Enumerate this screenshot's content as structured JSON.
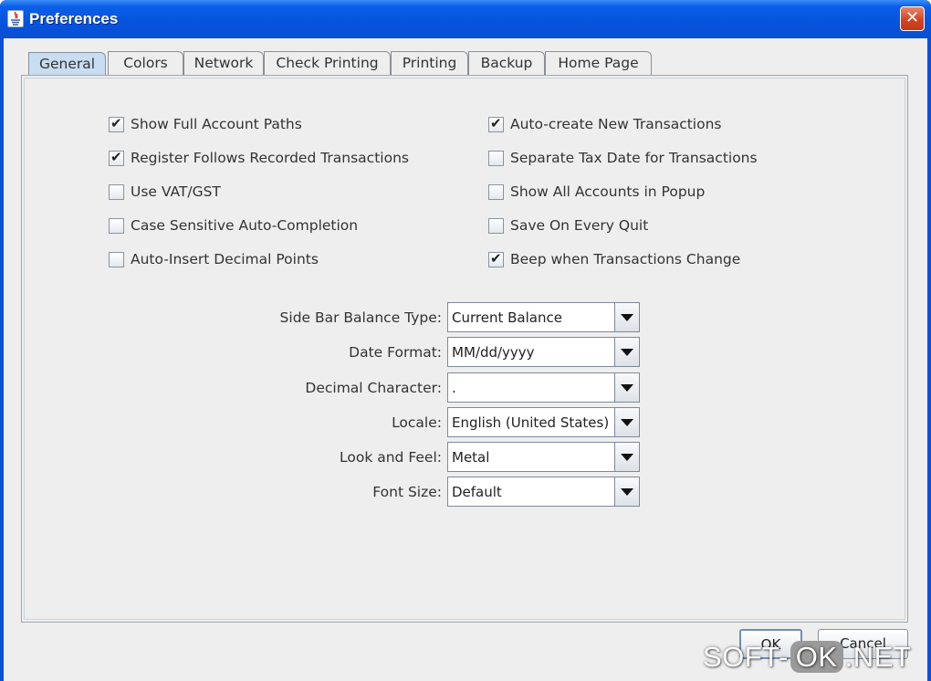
{
  "window": {
    "title": "Preferences",
    "close_glyph": "✕"
  },
  "tabs": [
    {
      "label": "General",
      "active": true
    },
    {
      "label": "Colors",
      "active": false
    },
    {
      "label": "Network",
      "active": false
    },
    {
      "label": "Check Printing",
      "active": false
    },
    {
      "label": "Printing",
      "active": false
    },
    {
      "label": "Backup",
      "active": false
    },
    {
      "label": "Home Page",
      "active": false
    }
  ],
  "general": {
    "checkboxes_left": [
      {
        "label": "Show Full Account Paths",
        "checked": true
      },
      {
        "label": "Register Follows Recorded Transactions",
        "checked": true
      },
      {
        "label": "Use VAT/GST",
        "checked": false
      },
      {
        "label": "Case Sensitive Auto-Completion",
        "checked": false
      },
      {
        "label": "Auto-Insert Decimal Points",
        "checked": false
      }
    ],
    "checkboxes_right": [
      {
        "label": "Auto-create New Transactions",
        "checked": true
      },
      {
        "label": "Separate Tax Date for Transactions",
        "checked": false
      },
      {
        "label": "Show All Accounts in Popup",
        "checked": false
      },
      {
        "label": "Save On Every Quit",
        "checked": false
      },
      {
        "label": "Beep when Transactions Change",
        "checked": true
      }
    ],
    "fields": [
      {
        "label": "Side Bar Balance Type:",
        "value": "Current Balance"
      },
      {
        "label": "Date Format:",
        "value": "MM/dd/yyyy"
      },
      {
        "label": "Decimal Character:",
        "value": "."
      },
      {
        "label": "Locale:",
        "value": "English (United States)"
      },
      {
        "label": "Look and Feel:",
        "value": "Metal"
      },
      {
        "label": "Font Size:",
        "value": "Default"
      }
    ]
  },
  "buttons": {
    "ok": "OK",
    "cancel": "Cancel"
  },
  "watermark": {
    "part1": "SOFT-",
    "part2": "OK",
    "part3": ".NET"
  }
}
